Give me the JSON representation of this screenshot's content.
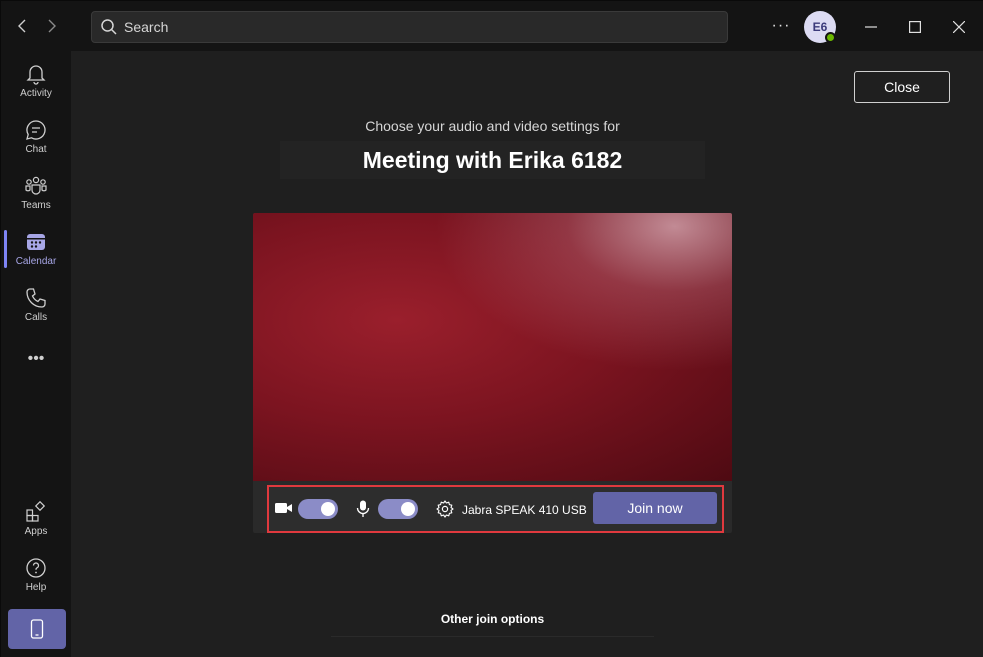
{
  "titlebar": {
    "search_placeholder": "Search",
    "avatar_initials": "E6",
    "presence_color": "#6bb700"
  },
  "rail": {
    "items": [
      {
        "label": "Activity",
        "icon": "bell-icon"
      },
      {
        "label": "Chat",
        "icon": "chat-icon"
      },
      {
        "label": "Teams",
        "icon": "teams-icon"
      },
      {
        "label": "Calendar",
        "icon": "calendar-icon",
        "active": true
      },
      {
        "label": "Calls",
        "icon": "phone-icon"
      }
    ],
    "more": "•••",
    "apps_label": "Apps",
    "help_label": "Help"
  },
  "main": {
    "close_label": "Close",
    "choose_text": "Choose your audio and video settings for",
    "meeting_title": "Meeting with Erika 6182",
    "controls": {
      "camera_on": true,
      "mic_on": true,
      "device_label": "Jabra SPEAK 410 USB",
      "join_label": "Join now"
    },
    "other_options": "Other join options"
  },
  "colors": {
    "accent": "#6264a7",
    "highlight_border": "#e0393e",
    "toggle_on": "#8b8cc7"
  }
}
